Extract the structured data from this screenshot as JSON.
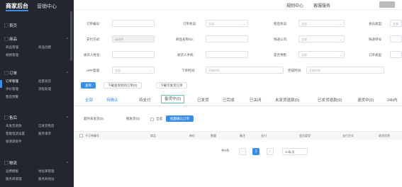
{
  "header": {
    "brand": "商家后台",
    "sub_nav": "营销中心",
    "links": [
      "规则中心",
      "客服服务"
    ]
  },
  "sidebar": {
    "home": "首页",
    "sections": [
      {
        "label": "商品",
        "items": [
          "商品管理",
          "商品创建",
          "规格管理"
        ]
      },
      {
        "label": "订单",
        "items": [
          "订单管理",
          "批量发货",
          "评价管理",
          "流程处理",
          "售后预警"
        ]
      },
      {
        "label": "售后",
        "items": [
          "未发货退款",
          "已发货售后",
          "客服电话设置",
          "服务请求",
          "极速退助手"
        ]
      },
      {
        "label": "物流",
        "items": [
          "运费模板",
          "地址库管理",
          "服务商管理",
          "服务商地址"
        ]
      }
    ]
  },
  "form": {
    "order_no": "订单编号:",
    "order_status": "订单状态:",
    "order_status_val": "全部",
    "pay_status": "售后状态:",
    "pay_status_val": "全部",
    "member": "会员类型:",
    "member_val": "全部",
    "pay_method": "支付方式:",
    "pay_method_val": "请选择",
    "product": "商品名称/ID:",
    "express": "快递公司:",
    "express_val": "全部",
    "express_no": "快递单号:",
    "receiver": "收货人姓名:",
    "receiver_phone": "收货人手机:",
    "presale": "是否预售:",
    "presale_val": "全部",
    "order_type": "订单类型:",
    "app_channel": "APP渠道:",
    "app_channel_val": "全部",
    "order_time": "下单时间:",
    "order_time_ph": "开始时间",
    "finish_time": "完成时间:",
    "finish_time_ph": "开始时间",
    "query": "查询",
    "export": "下载查询到的订单(0)",
    "view_export": "下载可发货订单"
  },
  "tabs": [
    "全部",
    "待确认",
    "待支付",
    "备货中(0)",
    "已发货",
    "已完成",
    "已关闭",
    "未发货退款(0)",
    "已发货退款(0)",
    "退货中(0)",
    "24h内"
  ],
  "actions": {
    "overdue": "超时未发货(0)",
    "urge": "催发货(0)",
    "select_all": "全选",
    "batch": "批量确认订单"
  },
  "table_headers": [
    "子订单编号",
    "商品",
    "单价",
    "数量",
    "备注",
    "支付",
    "会员类型",
    "支付方式",
    "收货信息"
  ],
  "pager": {
    "total": "共0条",
    "page": "1",
    "size": "20条/页"
  }
}
